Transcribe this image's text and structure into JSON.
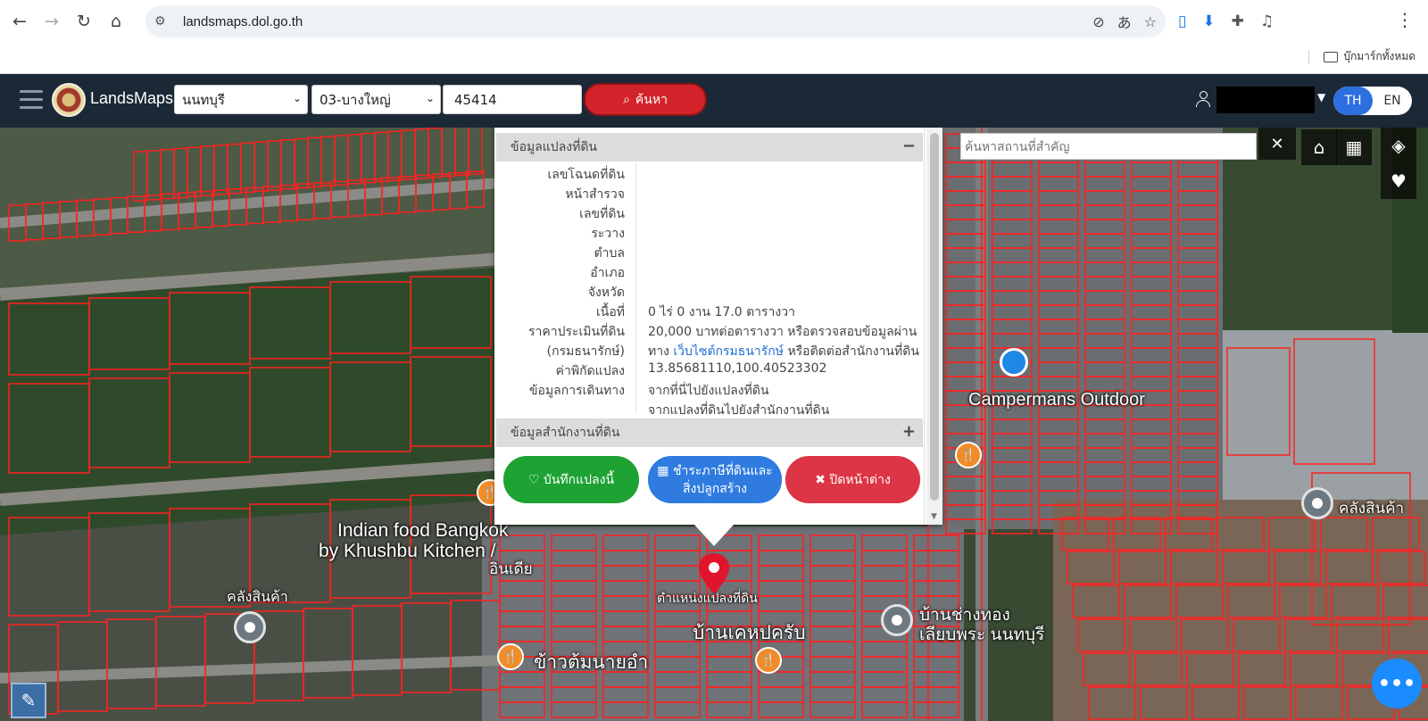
{
  "browser": {
    "url": "landsmaps.dol.go.th",
    "bookmarks_all": "บุ๊กมาร์กทั้งหมด"
  },
  "header": {
    "app_title": "LandsMaps",
    "province": "นนทบุรี",
    "district": "03-บางใหญ่",
    "parcel_number": "45414",
    "search_label": "ค้นหา",
    "lang_th": "TH",
    "lang_en": "EN"
  },
  "popup": {
    "land_section_title": "ข้อมูลแปลงที่ดิน",
    "land_section_toggle": "−",
    "rows": [
      {
        "label": "เลขโฉนดที่ดิน",
        "value": ""
      },
      {
        "label": "หน้าสำรวจ",
        "value": ""
      },
      {
        "label": "เลขที่ดิน",
        "value": ""
      },
      {
        "label": "ระวาง",
        "value": ""
      },
      {
        "label": "ตำบล",
        "value": ""
      },
      {
        "label": "อำเภอ",
        "value": ""
      },
      {
        "label": "จังหวัด",
        "value": ""
      },
      {
        "label": "เนื้อที่",
        "value": "0 ไร่ 0 งาน 17.0 ตารางวา"
      }
    ],
    "appraisal_label_1": "ราคาประเมินที่ดิน",
    "appraisal_label_2": "(กรมธนารักษ์)",
    "appraisal_value_1": "20,000 บาทต่อตารางวา หรือตรวจสอบข้อมูลผ่าน",
    "appraisal_value_2_prefix": "ทาง",
    "appraisal_link": "เว็บไซต์กรมธนารักษ์",
    "appraisal_value_2_suffix": "หรือติดต่อสำนักงานที่ดิน",
    "coord_label": "ค่าพิกัดแปลง",
    "coord_value": "13.85681110,100.40523302",
    "travel_label": "ข้อมูลการเดินทาง",
    "travel_link_1": "จากที่นี่ไปยังแปลงที่ดิน",
    "travel_link_2": "จากแปลงที่ดินไปยังสำนักงานที่ดิน",
    "office_section_title": "ข้อมูลสำนักงานที่ดิน",
    "office_section_toggle": "+",
    "btn_save": "บันทึกแปลงนี้",
    "btn_tax_1": "ชำระภาษีที่ดินและ",
    "btn_tax_2": "สิ่งปลูกสร้าง",
    "btn_close": "ปิดหน้าต่าง"
  },
  "map": {
    "place_search_placeholder": "ค้นหาสถานที่สำคัญ",
    "labels": {
      "campermans": "Campermans Outdoor",
      "indian_food_1": "Indian food Bangkok",
      "indian_food_2": "by Khushbu Kitchen /",
      "indian_food_3": "อินเดีย",
      "warehouse_right": "คลังสินค้า",
      "warehouse_left": "คลังสินค้า",
      "parcel_position": "ตำแหน่งแปลงที่ดิน",
      "ban_kan": "บ้านเคหปครับ",
      "khao_tom": "ข้าวต้มนายอำ",
      "ban_chang_1": "บ้านช่างทอง",
      "ban_chang_2": "เลียบพระ นนทบุรี"
    }
  },
  "colors": {
    "header_bg": "#1b2937",
    "search_red": "#d2232a",
    "parcel_line": "#ff2020",
    "save_green": "#1da233",
    "tax_blue": "#2f7be0",
    "close_red": "#dc3545"
  }
}
